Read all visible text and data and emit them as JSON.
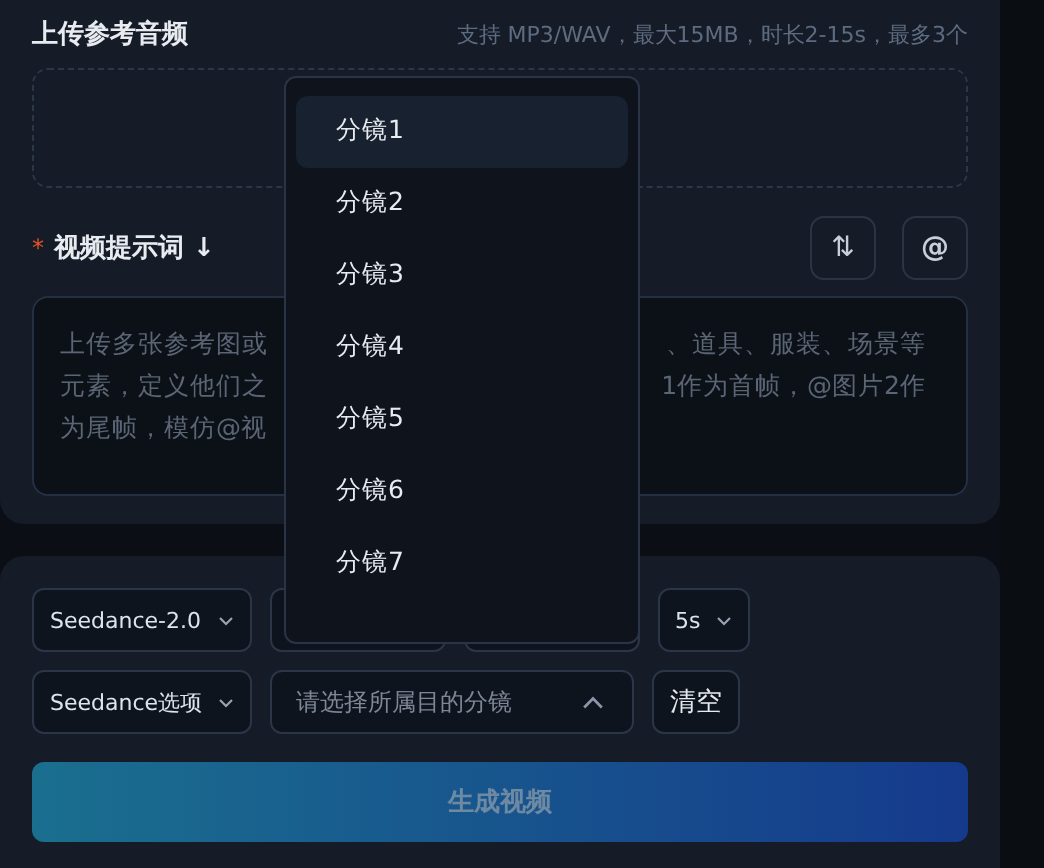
{
  "audio": {
    "title": "上传参考音频",
    "hint": "支持 MP3/WAV，最大15MB，时长2-15s，最多3个"
  },
  "prompt": {
    "label": "视频提示词 ↓",
    "required_mark": "*",
    "buttons": [
      {
        "kind": "swap",
        "label": "⇅"
      },
      {
        "kind": "mention",
        "label": "@"
      }
    ],
    "placeholder_lines": [
      {
        "left": "上传多张参考图或",
        "right": "、道具、服装、场景等"
      },
      {
        "left": "元素，定义他们之",
        "right": "1作为首帧，@图片2作"
      },
      {
        "left": "为尾帧，模仿@视"
      }
    ]
  },
  "controls": {
    "row1": [
      {
        "kind": "select",
        "value": "Seedance-2.0"
      },
      {
        "kind": "blank"
      },
      {
        "kind": "blank"
      },
      {
        "kind": "select",
        "value": "5s"
      }
    ],
    "row2": [
      {
        "kind": "select",
        "value": "Seedance选项"
      },
      {
        "kind": "target",
        "placeholder": "请选择所属目的分镜",
        "expanded": true
      },
      {
        "kind": "button",
        "value": "清空"
      }
    ]
  },
  "generate": {
    "label": "生成视频",
    "disabled": true
  },
  "dropdown": {
    "options": [
      {
        "label": "分镜1",
        "selected": true
      },
      {
        "label": "分镜2",
        "selected": false
      },
      {
        "label": "分镜3",
        "selected": false
      },
      {
        "label": "分镜4",
        "selected": false
      },
      {
        "label": "分镜5",
        "selected": false
      },
      {
        "label": "分镜6",
        "selected": false
      },
      {
        "label": "分镜7",
        "selected": false
      }
    ]
  }
}
